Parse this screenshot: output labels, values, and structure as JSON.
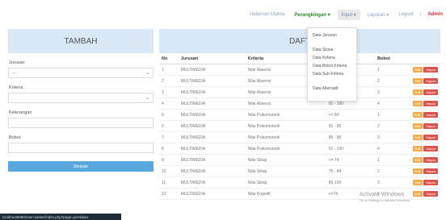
{
  "nav": {
    "halaman_utama": "Halaman Utama",
    "perangkingan": "Perangkingan",
    "input": "Input",
    "laporan": "Laporan",
    "logout": "Logout",
    "admin": "Admin",
    "chevron": "▾"
  },
  "dropdown": {
    "items": [
      "Data Jurusan",
      "Data Siswa",
      "Data Kriteria",
      "Data Bobot Kriteria",
      "Data Sub Kriteria",
      "Data Alternatif"
    ]
  },
  "left": {
    "title": "TAMBAH",
    "jurusan_label": "Jurusan",
    "jurusan_value": "---",
    "kriteria_label": "Kriteria",
    "kriteria_value": "",
    "keterangan_label": "Keterangan",
    "keterangan_value": "",
    "bobot_label": "Bobot",
    "bobot_value": "",
    "submit_label": "Simpan"
  },
  "right": {
    "title": "DAFT",
    "headers": [
      "No",
      "Jurusan",
      "Kriteria",
      "",
      "Bobot",
      ""
    ],
    "edit_label": "Edit",
    "delete_label": "Hapus",
    "rows": [
      [
        "1",
        "MULTIMEDIA",
        "Nilai Absensi",
        "",
        "1"
      ],
      [
        "2",
        "MULTIMEDIA",
        "Nilai Absensi",
        "",
        "2"
      ],
      [
        "3",
        "MULTIMEDIA",
        "Nilai Absensi",
        "86 - 90",
        "3"
      ],
      [
        "4",
        "MULTIMEDIA",
        "Nilai Absensi",
        "91 - 100",
        "4"
      ],
      [
        "5",
        "MULTIMEDIA",
        "Nilai Psikomotorik",
        "<= 80",
        "1"
      ],
      [
        "6",
        "MULTIMEDIA",
        "Nilai Psikomotorik",
        "81 - 85",
        "2"
      ],
      [
        "7",
        "MULTIMEDIA",
        "Nilai Psikomotorik",
        "86 - 90",
        "3"
      ],
      [
        "8",
        "MULTIMEDIA",
        "Nilai Psikomotorik",
        "91 - 100",
        "4"
      ],
      [
        "9",
        "MULTIMEDIA",
        "Nilai Sikap",
        "<= 74",
        "1"
      ],
      [
        "10",
        "MULTIMEDIA",
        "Nilai Sikap",
        "75 - 84",
        "2"
      ],
      [
        "11",
        "MULTIMEDIA",
        "Nilai Sikap",
        "85-100",
        "3"
      ],
      [
        "12",
        "MULTIMEDIA",
        "Nilai Kognitif",
        "<=74",
        "1"
      ]
    ]
  },
  "statusbar": {
    "url": "localhost8080/saw master/index.php?page=penilaian"
  },
  "watermark": {
    "line1": "Activate Windows",
    "line2": "Go to Settings to activate Windows."
  }
}
